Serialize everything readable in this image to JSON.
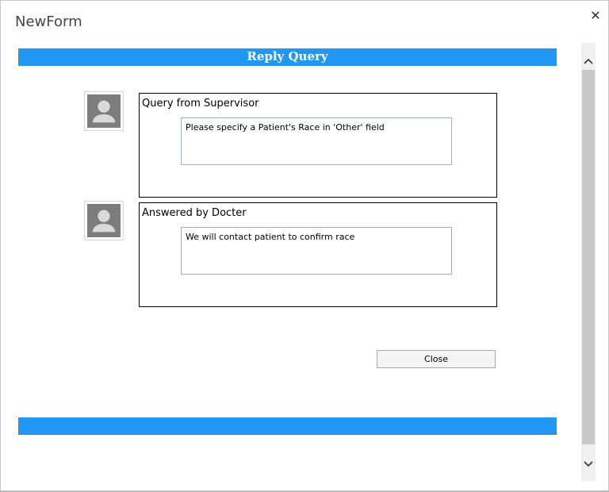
{
  "window": {
    "title": "NewForm",
    "close_glyph": "✕"
  },
  "header": {
    "title": "Reply Query"
  },
  "query": {
    "label": "Query from Supervisor",
    "text": "Please specify a Patient's Race in 'Other' field",
    "avatar_icon": "user-silhouette-icon"
  },
  "answer": {
    "label": "Answered by Docter",
    "text": "We will contact patient to confirm race",
    "avatar_icon": "user-silhouette-icon"
  },
  "actions": {
    "close_label": "Close"
  },
  "colors": {
    "accent": "#2196f3",
    "panel_border": "#000000"
  }
}
